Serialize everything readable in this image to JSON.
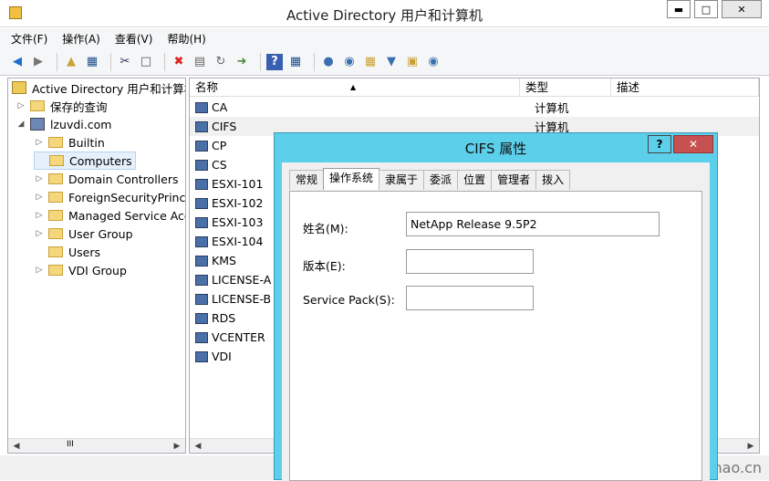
{
  "window": {
    "title": "Active Directory 用户和计算机",
    "btn_min": "▬",
    "btn_max": "□",
    "btn_close": "✕"
  },
  "menu": [
    "文件(F)",
    "操作(A)",
    "查看(V)",
    "帮助(H)"
  ],
  "toolbar_icons": [
    "back-icon",
    "forward-icon",
    "up-icon",
    "details-icon",
    "cut-icon",
    "copy-icon",
    "delete-icon",
    "properties-icon",
    "refresh-icon",
    "export-icon",
    "help-icon",
    "console-icon",
    "user-icon",
    "group-icon",
    "ou-icon",
    "filter-icon",
    "find-icon",
    "add-group-icon"
  ],
  "tree": {
    "root": "Active Directory 用户和计算机",
    "saved_queries": "保存的查询",
    "domain": "lzuvdi.com",
    "items": [
      "Builtin",
      "Computers",
      "Domain Controllers",
      "ForeignSecurityPrincipa",
      "Managed Service Acco",
      "User Group",
      "Users",
      "VDI Group"
    ],
    "scroll_mid": "III"
  },
  "list": {
    "columns": [
      "名称",
      "类型",
      "描述"
    ],
    "rows": [
      {
        "name": "CA",
        "type": "计算机"
      },
      {
        "name": "CIFS",
        "type": "计算机"
      },
      {
        "name": "CP",
        "type": ""
      },
      {
        "name": "CS",
        "type": ""
      },
      {
        "name": "ESXI-101",
        "type": ""
      },
      {
        "name": "ESXI-102",
        "type": ""
      },
      {
        "name": "ESXI-103",
        "type": ""
      },
      {
        "name": "ESXI-104",
        "type": ""
      },
      {
        "name": "KMS",
        "type": ""
      },
      {
        "name": "LICENSE-A",
        "type": ""
      },
      {
        "name": "LICENSE-B",
        "type": ""
      },
      {
        "name": "RDS",
        "type": ""
      },
      {
        "name": "VCENTER",
        "type": ""
      },
      {
        "name": "VDI",
        "type": ""
      }
    ]
  },
  "dialog": {
    "title": "CIFS 属性",
    "help": "?",
    "close": "✕",
    "tabs": [
      "常规",
      "操作系统",
      "隶属于",
      "委派",
      "位置",
      "管理者",
      "拨入"
    ],
    "fields": {
      "name_label": "姓名(M):",
      "name_value": "NetApp Release 9.5P2",
      "version_label": "版本(E):",
      "version_value": "",
      "sp_label": "Service Pack(S):",
      "sp_value": ""
    }
  },
  "watermark": "https://www.mr-mao.cn"
}
